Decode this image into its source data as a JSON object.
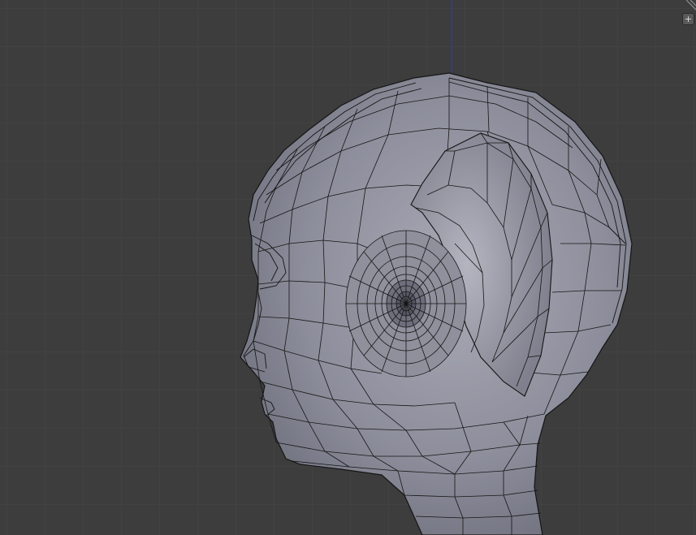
{
  "viewport": {
    "background": "#3d3d3d",
    "grid_color": "#474747",
    "z_axis_color": "#2c3c9a",
    "mesh_fill": "#8c8d9a",
    "mesh_wire": "#151515",
    "icons": {
      "expand": "plus-icon",
      "corner": "region-split-icon"
    },
    "labels": {
      "expand": "+"
    }
  }
}
